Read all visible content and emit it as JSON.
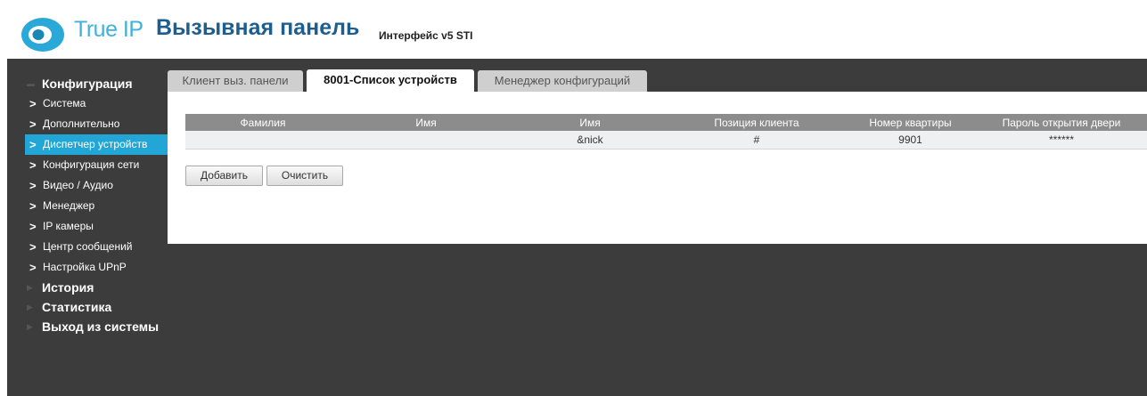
{
  "header": {
    "brand": "True IP",
    "title": "Вызывная панель",
    "interface": "Интерфейс v5 STI",
    "brand_color": "#3fb1dc",
    "title_color": "#1e5e8e"
  },
  "sidebar": {
    "config_label": "Конфигурация",
    "items": [
      {
        "label": "Система"
      },
      {
        "label": "Дополнительно"
      },
      {
        "label": "Диспетчер устройств"
      },
      {
        "label": "Конфигурация сети"
      },
      {
        "label": "Видео / Аудио"
      },
      {
        "label": "Менеджер"
      },
      {
        "label": "IP камеры"
      },
      {
        "label": "Центр сообщений"
      },
      {
        "label": "Настройка UPnP"
      }
    ],
    "active_index": 2,
    "sections": [
      {
        "label": "История"
      },
      {
        "label": "Статистика"
      },
      {
        "label": "Выход из системы"
      }
    ],
    "active_color": "#21a6d6"
  },
  "tabs": [
    {
      "label": "Клиент выз. панели",
      "active": false
    },
    {
      "label": "8001-Список устройств",
      "active": true
    },
    {
      "label": "Менеджер конфигураций",
      "active": false
    }
  ],
  "table": {
    "headers": [
      "Фамилия",
      "Имя",
      "Имя",
      "Позиция клиента",
      "Номер квартиры",
      "Пароль открытия двери"
    ],
    "rows": [
      [
        "",
        "",
        "&nick",
        "#",
        "9901",
        "******"
      ]
    ]
  },
  "buttons": {
    "add": "Добавить",
    "clear": "Очистить"
  },
  "colors": {
    "background_dark": "#3c3c3c",
    "table_header": "#8c8c8c"
  }
}
